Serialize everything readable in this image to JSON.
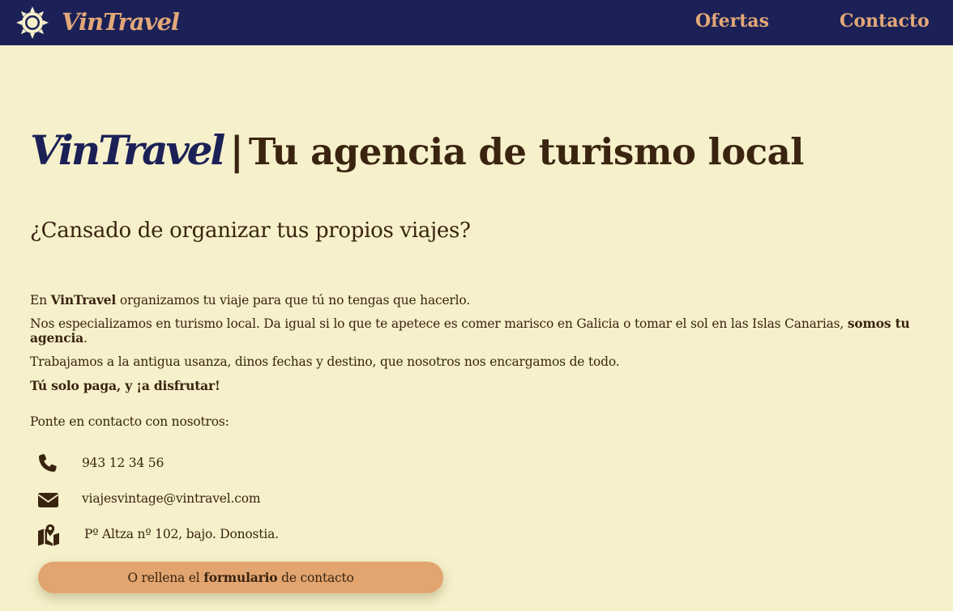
{
  "nav": {
    "brand": "VinTravel",
    "links": [
      {
        "label": "Ofertas"
      },
      {
        "label": "Contacto"
      }
    ],
    "logo_icon": "sun-icon"
  },
  "hero": {
    "brand": "VinTravel",
    "separator": "|",
    "tagline": "Tu agencia de turismo local"
  },
  "subtitle": "¿Cansado de organizar tus propios viajes?",
  "paragraphs": {
    "p1_pre": "En ",
    "p1_bold": "VinTravel",
    "p1_post": " organizamos tu viaje para que tú no tengas que hacerlo.",
    "p2_pre": "Nos especializamos en turismo local. Da igual si lo que te apetece es comer marisco en Galicia o tomar el sol en las Islas Canarias, ",
    "p2_bold": "somos tu agencia",
    "p2_post": ".",
    "p3": "Trabajamos a la antigua usanza, dinos fechas y destino, que nosotros nos encargamos de todo.",
    "p4": "Tú solo paga, y ¡a disfrutar!",
    "p5": "Ponte en contacto con nosotros:"
  },
  "contact": {
    "phone": {
      "icon": "phone-icon",
      "text": "943 12 34 56"
    },
    "email": {
      "icon": "envelope-icon",
      "text": "viajesvintage@vintravel.com"
    },
    "address": {
      "icon": "map-icon",
      "text": "Pº Altza nº 102, bajo. Donostia."
    }
  },
  "form_button": {
    "pre": "O rellena el ",
    "bold": "formulario",
    "post": " de contacto"
  },
  "colors": {
    "navbar": "#1b2157",
    "accent": "#e2a878",
    "background": "#f6f1cb",
    "text": "#3a2410",
    "button": "#e2a570"
  }
}
